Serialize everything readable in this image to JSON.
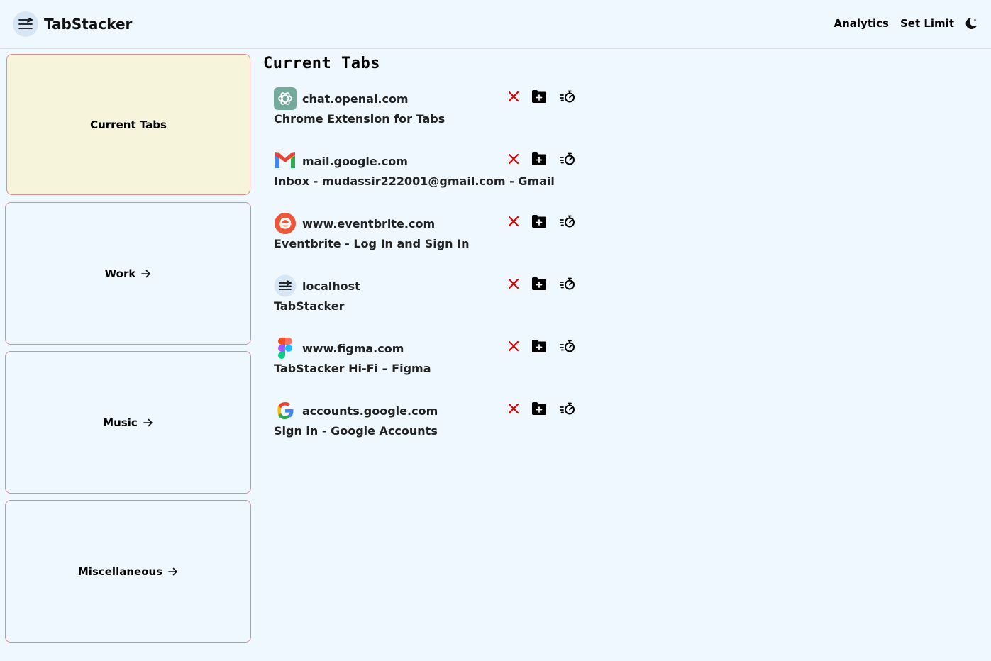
{
  "header": {
    "app_title": "TabStacker",
    "nav": {
      "analytics": "Analytics",
      "set_limit": "Set Limit"
    }
  },
  "sidebar": {
    "items": [
      {
        "label": "Current Tabs",
        "active": true
      },
      {
        "label": "Work",
        "arrow": true
      },
      {
        "label": "Music",
        "arrow": true
      },
      {
        "label": "Miscellaneous",
        "arrow": true
      }
    ]
  },
  "main": {
    "title": "Current Tabs",
    "tabs": [
      {
        "domain": "chat.openai.com",
        "title": "Chrome Extension for Tabs",
        "icon": "openai-icon"
      },
      {
        "domain": "mail.google.com",
        "title": "Inbox - mudassir222001@gmail.com - Gmail",
        "icon": "gmail-icon"
      },
      {
        "domain": "www.eventbrite.com",
        "title": "Eventbrite - Log In and Sign In",
        "icon": "eventbrite-icon"
      },
      {
        "domain": "localhost",
        "title": "TabStacker",
        "icon": "tabstacker-icon"
      },
      {
        "domain": "www.figma.com",
        "title": "TabStacker Hi-Fi – Figma",
        "icon": "figma-icon"
      },
      {
        "domain": "accounts.google.com",
        "title": "Sign in - Google Accounts",
        "icon": "google-icon"
      }
    ]
  },
  "colors": {
    "background": "#f0f8ff",
    "active_card": "#f6f5dc",
    "card_border": "#e08d8d",
    "close_red": "#e00000"
  }
}
